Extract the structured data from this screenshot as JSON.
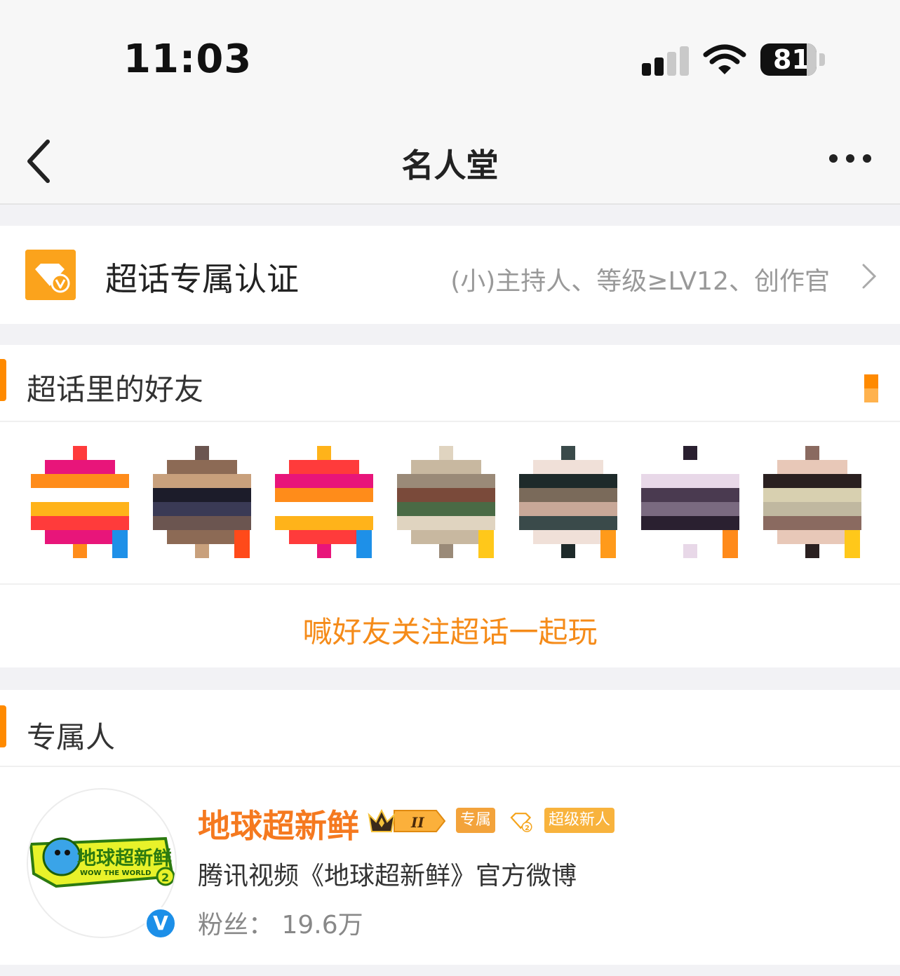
{
  "status_bar": {
    "time": "11:03",
    "battery": "81",
    "signal_bars_active": 2
  },
  "nav": {
    "title": "名人堂"
  },
  "certification": {
    "label": "超话专属认证",
    "description": "(小)主持人、等级≥LV12、创作官"
  },
  "friends": {
    "title": "超话里的好友",
    "invite_text": "喊好友关注超话一起玩",
    "avatars": [
      {
        "palette": [
          "#ff3b3b",
          "#ff8c1a",
          "#ffb31a",
          "#e8157a",
          "#ffffff"
        ],
        "badge": "#1e90e8"
      },
      {
        "palette": [
          "#1c1c2a",
          "#6b5550",
          "#c8a07c",
          "#3a3a55",
          "#8c6a55"
        ],
        "badge": "#ff4a1a"
      },
      {
        "palette": [
          "#ff3b3b",
          "#ff8c1a",
          "#ffb31a",
          "#e8157a",
          "#ffffff"
        ],
        "badge": "#1e90e8"
      },
      {
        "palette": [
          "#4a6a45",
          "#c8b8a0",
          "#7a4a3a",
          "#e0d4c0",
          "#9a8a78"
        ],
        "badge": "#ffc81a"
      },
      {
        "palette": [
          "#1e2a2a",
          "#c8a898",
          "#f0e0d8",
          "#7a6a5a",
          "#3a4a4a"
        ],
        "badge": "#ff9a1a"
      },
      {
        "palette": [
          "#2a2030",
          "#e8d8e8",
          "#7a6a80",
          "#ffffff",
          "#4a3a50"
        ],
        "badge": "#ff8a1a"
      },
      {
        "palette": [
          "#d8d0b0",
          "#8a6a60",
          "#2a2020",
          "#c0b8a0",
          "#e8c8b8"
        ],
        "badge": "#ffc81a"
      }
    ]
  },
  "exclusive": {
    "title": "专属人",
    "person": {
      "name": "地球超新鲜",
      "crown_level": "II",
      "badge_exclusive": "专属",
      "badge_gem_level": "2",
      "badge_newbie": "超级新人",
      "description": "腾讯视频《地球超新鲜》官方微博",
      "fans_label": "粉丝：",
      "fans_value": "19.6万",
      "logo_text": "地球超新鲜",
      "logo_subtext": "WOW THE WORLD",
      "verified_mark": "V"
    }
  },
  "colors": {
    "accent": "#ff8a00",
    "name": "#f5791f",
    "verified": "#1c8fe8"
  }
}
